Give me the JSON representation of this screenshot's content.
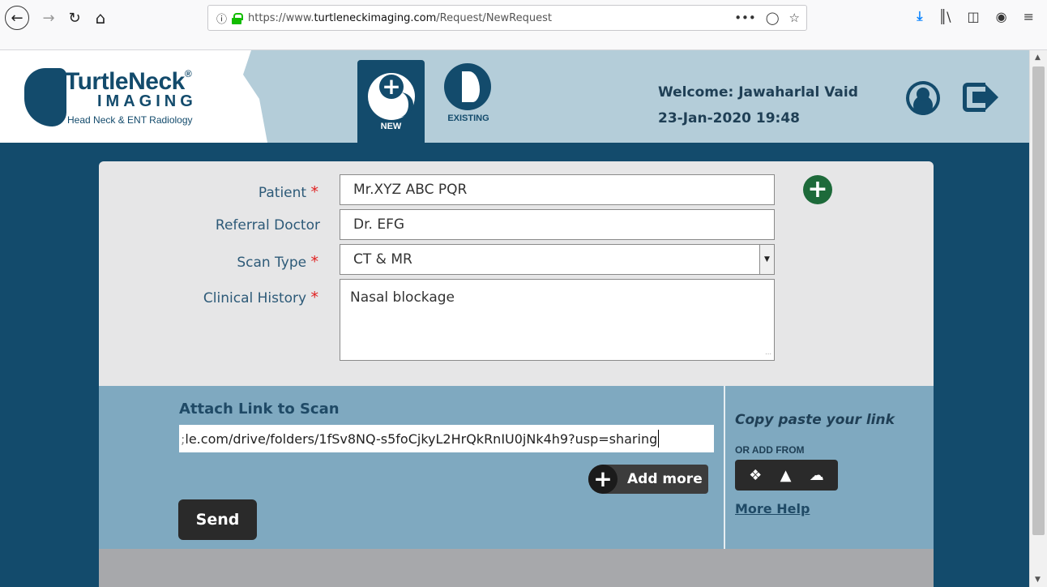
{
  "browser": {
    "url_prefix": "https://www.",
    "url_host": "turtleneckimaging.com",
    "url_path": "/Request/NewRequest",
    "page_actions": "•••",
    "back_glyph": "←",
    "forward_glyph": "→",
    "reload_glyph": "↻",
    "home_glyph": "⌂"
  },
  "logo": {
    "title": "TurtleNeck",
    "registered": "®",
    "subtitle": "IMAGING",
    "tagline": "Head Neck & ENT Radiology"
  },
  "tabs": [
    {
      "label": "NEW",
      "active": true
    },
    {
      "label": "EXISTING",
      "active": false
    }
  ],
  "header": {
    "welcome": "Welcome: Jawaharlal Vaid",
    "datetime": "23-Jan-2020 19:48"
  },
  "form": {
    "patient_label": "Patient",
    "patient_value": "Mr.XYZ ABC PQR",
    "referral_label": "Referral Doctor",
    "referral_value": "Dr. EFG",
    "scan_type_label": "Scan Type",
    "scan_type_value": "CT & MR",
    "clinical_label": "Clinical History",
    "clinical_value": "Nasal blockage",
    "required_mark": "*"
  },
  "attach": {
    "title": "Attach Link to Scan",
    "link_value": "le.com/drive/folders/1fSv8NQ-s5foCjkyL2HrQkRnIU0jNk4h9?usp=sharing",
    "link_prefix_glyph": ";",
    "add_more_label": "Add more",
    "send_label": "Send",
    "copy_paste_text": "Copy paste your link",
    "or_add_from": "OR ADD FROM",
    "more_help": "More Help"
  },
  "colors": {
    "brand_dark": "#134b6c",
    "header_bg": "#b4cdd9",
    "attach_bg": "#7fa9c0",
    "add_green": "#1d6a3a",
    "required_red": "#e02020"
  }
}
